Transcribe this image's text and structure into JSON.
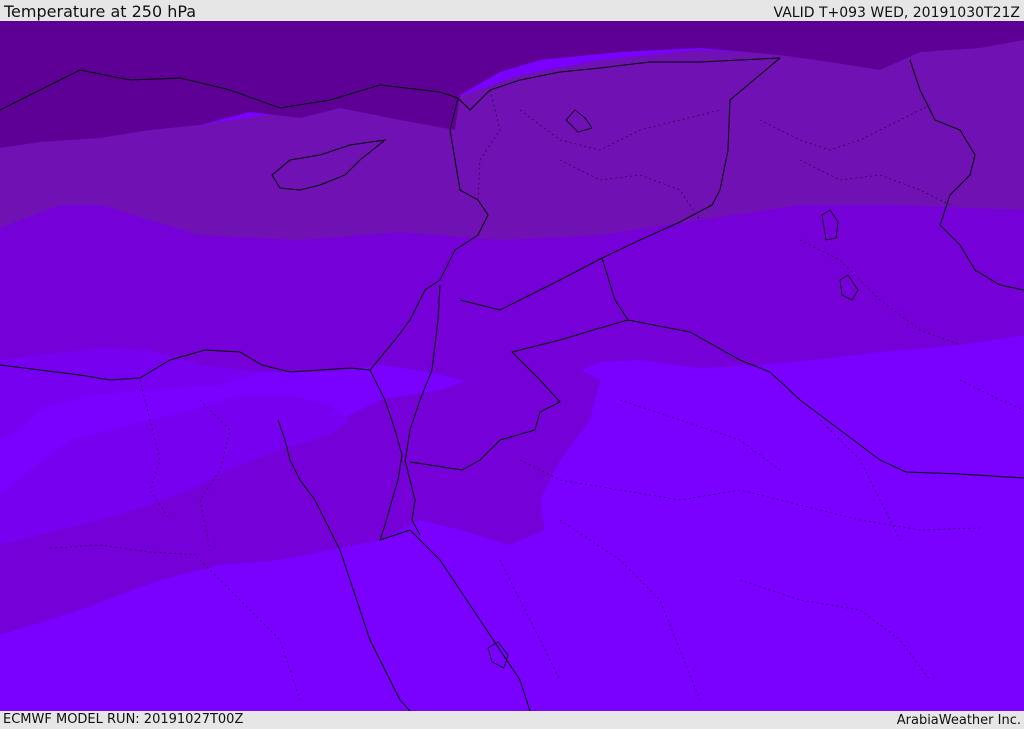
{
  "header": {
    "title": "Temperature at 250 hPa",
    "valid_time": "VALID T+093 WED, 20191030T21Z"
  },
  "footer": {
    "model_run": "ECMWF MODEL RUN: 20191027T00Z",
    "credit": "ArabiaWeather Inc."
  },
  "map": {
    "field": "temperature",
    "level": "250 hPa",
    "colors": {
      "band_darkest": "#5e0096",
      "band_dark": "#7011b3",
      "band_mid": "#7600d8",
      "band_light": "#7800f0",
      "band_lightest": "#7a00ff",
      "coastline": "#000000"
    }
  }
}
